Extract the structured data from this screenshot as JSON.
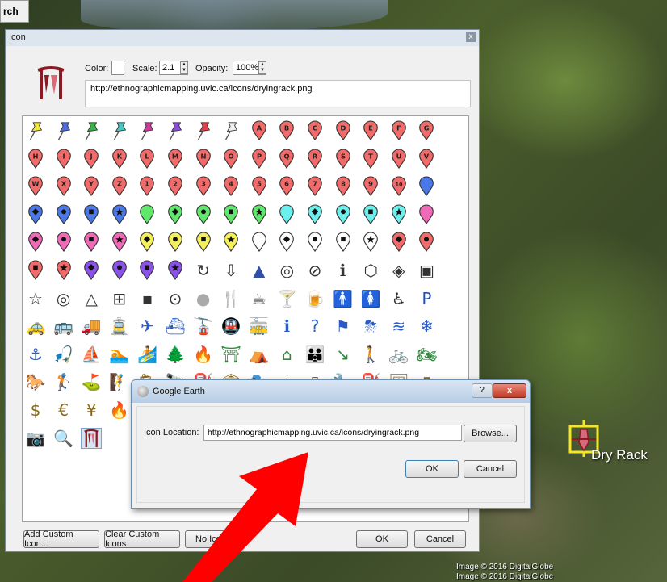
{
  "app": {
    "search_tab": "rch"
  },
  "icon_dialog": {
    "title": "Icon",
    "close_glyph": "x",
    "color_label": "Color:",
    "scale_label": "Scale:",
    "scale_value": "2.1",
    "opacity_label": "Opacity:",
    "opacity_value": "100%",
    "url": "http://ethnographicmapping.uvic.ca/icons/dryingrack.png",
    "buttons": {
      "add_custom": "Add Custom Icon...",
      "clear_custom": "Clear Custom Icons",
      "no_icon": "No Ico",
      "ok": "OK",
      "cancel": "Cancel"
    },
    "grid": {
      "rows": [
        [
          {
            "t": "pushpin",
            "c": "#f2e53c"
          },
          {
            "t": "pushpin",
            "c": "#4a6ee0"
          },
          {
            "t": "pushpin",
            "c": "#3bb34a"
          },
          {
            "t": "pushpin",
            "c": "#4bc6c0"
          },
          {
            "t": "pushpin",
            "c": "#d13a9d"
          },
          {
            "t": "pushpin",
            "c": "#8b4ed6"
          },
          {
            "t": "pushpin",
            "c": "#e0404a"
          },
          {
            "t": "pushpin",
            "c": "#eeeeee"
          },
          {
            "t": "pin",
            "c": "#f26b6b",
            "l": "A"
          },
          {
            "t": "pin",
            "c": "#f26b6b",
            "l": "B"
          },
          {
            "t": "pin",
            "c": "#f26b6b",
            "l": "C"
          },
          {
            "t": "pin",
            "c": "#f26b6b",
            "l": "D"
          },
          {
            "t": "pin",
            "c": "#f26b6b",
            "l": "E"
          },
          {
            "t": "pin",
            "c": "#f26b6b",
            "l": "F"
          },
          {
            "t": "pin",
            "c": "#f26b6b",
            "l": "G"
          }
        ],
        [
          {
            "t": "pin",
            "c": "#f26b6b",
            "l": "H"
          },
          {
            "t": "pin",
            "c": "#f26b6b",
            "l": "I"
          },
          {
            "t": "pin",
            "c": "#f26b6b",
            "l": "J"
          },
          {
            "t": "pin",
            "c": "#f26b6b",
            "l": "K"
          },
          {
            "t": "pin",
            "c": "#f26b6b",
            "l": "L"
          },
          {
            "t": "pin",
            "c": "#f26b6b",
            "l": "M"
          },
          {
            "t": "pin",
            "c": "#f26b6b",
            "l": "N"
          },
          {
            "t": "pin",
            "c": "#f26b6b",
            "l": "O"
          },
          {
            "t": "pin",
            "c": "#f26b6b",
            "l": "P"
          },
          {
            "t": "pin",
            "c": "#f26b6b",
            "l": "Q"
          },
          {
            "t": "pin",
            "c": "#f26b6b",
            "l": "R"
          },
          {
            "t": "pin",
            "c": "#f26b6b",
            "l": "S"
          },
          {
            "t": "pin",
            "c": "#f26b6b",
            "l": "T"
          },
          {
            "t": "pin",
            "c": "#f26b6b",
            "l": "U"
          },
          {
            "t": "pin",
            "c": "#f26b6b",
            "l": "V"
          }
        ],
        [
          {
            "t": "pin",
            "c": "#f26b6b",
            "l": "W"
          },
          {
            "t": "pin",
            "c": "#f26b6b",
            "l": "X"
          },
          {
            "t": "pin",
            "c": "#f26b6b",
            "l": "Y"
          },
          {
            "t": "pin",
            "c": "#f26b6b",
            "l": "Z"
          },
          {
            "t": "pin",
            "c": "#f26b6b",
            "l": "1"
          },
          {
            "t": "pin",
            "c": "#f26b6b",
            "l": "2"
          },
          {
            "t": "pin",
            "c": "#f26b6b",
            "l": "3"
          },
          {
            "t": "pin",
            "c": "#f26b6b",
            "l": "4"
          },
          {
            "t": "pin",
            "c": "#f26b6b",
            "l": "5"
          },
          {
            "t": "pin",
            "c": "#f26b6b",
            "l": "6"
          },
          {
            "t": "pin",
            "c": "#f26b6b",
            "l": "7"
          },
          {
            "t": "pin",
            "c": "#f26b6b",
            "l": "8"
          },
          {
            "t": "pin",
            "c": "#f26b6b",
            "l": "9"
          },
          {
            "t": "pin",
            "c": "#f26b6b",
            "l": "10"
          },
          {
            "t": "pin",
            "c": "#4a78e8"
          }
        ],
        [
          {
            "t": "pin",
            "c": "#4a78e8",
            "s": "diamond"
          },
          {
            "t": "pin",
            "c": "#4a78e8",
            "s": "circle"
          },
          {
            "t": "pin",
            "c": "#4a78e8",
            "s": "square"
          },
          {
            "t": "pin",
            "c": "#4a78e8",
            "s": "star"
          },
          {
            "t": "pin",
            "c": "#5fe86b"
          },
          {
            "t": "pin",
            "c": "#5fe86b",
            "s": "diamond"
          },
          {
            "t": "pin",
            "c": "#5fe86b",
            "s": "circle"
          },
          {
            "t": "pin",
            "c": "#5fe86b",
            "s": "square"
          },
          {
            "t": "pin",
            "c": "#5fe86b",
            "s": "star"
          },
          {
            "t": "pin",
            "c": "#6cf0ee"
          },
          {
            "t": "pin",
            "c": "#6cf0ee",
            "s": "diamond"
          },
          {
            "t": "pin",
            "c": "#6cf0ee",
            "s": "circle"
          },
          {
            "t": "pin",
            "c": "#6cf0ee",
            "s": "square"
          },
          {
            "t": "pin",
            "c": "#6cf0ee",
            "s": "star"
          },
          {
            "t": "pin",
            "c": "#f06ab8"
          }
        ],
        [
          {
            "t": "pin",
            "c": "#f06ab8",
            "s": "diamond"
          },
          {
            "t": "pin",
            "c": "#f06ab8",
            "s": "circle"
          },
          {
            "t": "pin",
            "c": "#f06ab8",
            "s": "square"
          },
          {
            "t": "pin",
            "c": "#f06ab8",
            "s": "star"
          },
          {
            "t": "pin",
            "c": "#f5ef5a",
            "s": "diamond"
          },
          {
            "t": "pin",
            "c": "#f5ef5a",
            "s": "circle"
          },
          {
            "t": "pin",
            "c": "#f5ef5a",
            "s": "square"
          },
          {
            "t": "pin",
            "c": "#f5ef5a",
            "s": "star"
          },
          {
            "t": "pin",
            "c": "#ffffff"
          },
          {
            "t": "pin",
            "c": "#ffffff",
            "s": "diamond"
          },
          {
            "t": "pin",
            "c": "#ffffff",
            "s": "circle"
          },
          {
            "t": "pin",
            "c": "#ffffff",
            "s": "square"
          },
          {
            "t": "pin",
            "c": "#ffffff",
            "s": "star"
          },
          {
            "t": "pin",
            "c": "#f26b6b",
            "s": "diamond"
          },
          {
            "t": "pin",
            "c": "#f26b6b",
            "s": "circle"
          }
        ],
        [
          {
            "t": "pin",
            "c": "#f26b6b",
            "s": "square"
          },
          {
            "t": "pin",
            "c": "#f26b6b",
            "s": "star"
          },
          {
            "t": "pin",
            "c": "#8a52e8",
            "s": "diamond"
          },
          {
            "t": "pin",
            "c": "#8a52e8",
            "s": "circle"
          },
          {
            "t": "pin",
            "c": "#8a52e8",
            "s": "square"
          },
          {
            "t": "pin",
            "c": "#8a52e8",
            "s": "star"
          },
          {
            "t": "g",
            "g": "↻"
          },
          {
            "t": "g",
            "g": "⇩"
          },
          {
            "t": "g",
            "g": "▲",
            "c": "#2f4fa8"
          },
          {
            "t": "g",
            "g": "◎"
          },
          {
            "t": "g",
            "g": "⊘"
          },
          {
            "t": "g",
            "g": "ℹ"
          },
          {
            "t": "g",
            "g": "⬡"
          },
          {
            "t": "g",
            "g": "◈"
          },
          {
            "t": "g",
            "g": "▣"
          }
        ],
        [
          {
            "t": "g",
            "g": "☆"
          },
          {
            "t": "g",
            "g": "◎"
          },
          {
            "t": "g",
            "g": "△"
          },
          {
            "t": "g",
            "g": "⊞"
          },
          {
            "t": "g",
            "g": "▪"
          },
          {
            "t": "g",
            "g": "⊙"
          },
          {
            "t": "g",
            "g": "●",
            "c": "#aaaaaa"
          },
          {
            "t": "g",
            "g": "🍴"
          },
          {
            "t": "g",
            "g": "☕"
          },
          {
            "t": "g",
            "g": "🍸"
          },
          {
            "t": "g",
            "g": "🍺"
          },
          {
            "t": "g",
            "g": "🚹"
          },
          {
            "t": "g",
            "g": "🚺"
          },
          {
            "t": "g",
            "g": "♿"
          },
          {
            "t": "g",
            "g": "P",
            "c": "#1c4fb8"
          }
        ],
        [
          {
            "t": "g",
            "g": "🚕",
            "c": "#2a5bc7"
          },
          {
            "t": "g",
            "g": "🚌",
            "c": "#2a5bc7"
          },
          {
            "t": "g",
            "g": "🚚",
            "c": "#2a5bc7"
          },
          {
            "t": "g",
            "g": "🚊",
            "c": "#2a5bc7"
          },
          {
            "t": "g",
            "g": "✈",
            "c": "#2a5bc7"
          },
          {
            "t": "g",
            "g": "⛴",
            "c": "#2a5bc7"
          },
          {
            "t": "g",
            "g": "🚡",
            "c": "#2a5bc7"
          },
          {
            "t": "g",
            "g": "🚇",
            "c": "#2a5bc7"
          },
          {
            "t": "g",
            "g": "🚋",
            "c": "#2a5bc7"
          },
          {
            "t": "g",
            "g": "ℹ",
            "c": "#2a5bc7"
          },
          {
            "t": "g",
            "g": "?",
            "c": "#2a5bc7"
          },
          {
            "t": "g",
            "g": "⚑",
            "c": "#2a5bc7"
          },
          {
            "t": "g",
            "g": "⛈",
            "c": "#2a5bc7"
          },
          {
            "t": "g",
            "g": "≋",
            "c": "#2a5bc7"
          },
          {
            "t": "g",
            "g": "❄",
            "c": "#2a5bc7"
          }
        ],
        [
          {
            "t": "g",
            "g": "⚓",
            "c": "#2a5bc7"
          },
          {
            "t": "g",
            "g": "🎣",
            "c": "#2a5bc7"
          },
          {
            "t": "g",
            "g": "⛵",
            "c": "#2a5bc7"
          },
          {
            "t": "g",
            "g": "🏊",
            "c": "#2a5bc7"
          },
          {
            "t": "g",
            "g": "🏄",
            "c": "#2a5bc7"
          },
          {
            "t": "g",
            "g": "🌲",
            "c": "#2f8a3a"
          },
          {
            "t": "g",
            "g": "🔥",
            "c": "#2f8a3a"
          },
          {
            "t": "g",
            "g": "⛩",
            "c": "#2f8a3a"
          },
          {
            "t": "g",
            "g": "⛺",
            "c": "#2f8a3a"
          },
          {
            "t": "g",
            "g": "⌂",
            "c": "#2f8a3a"
          },
          {
            "t": "g",
            "g": "👪",
            "c": "#2f8a3a"
          },
          {
            "t": "g",
            "g": "↘",
            "c": "#2f8a3a"
          },
          {
            "t": "g",
            "g": "🚶",
            "c": "#2f8a3a"
          },
          {
            "t": "g",
            "g": "🚲",
            "c": "#2f8a3a"
          },
          {
            "t": "g",
            "g": "🏍",
            "c": "#2f8a3a"
          }
        ],
        [
          {
            "t": "g",
            "g": "🐎",
            "c": "#2f8a3a"
          },
          {
            "t": "g",
            "g": "🏌",
            "c": "#2f8a3a"
          },
          {
            "t": "g",
            "g": "⛳",
            "c": "#2f8a3a"
          },
          {
            "t": "g",
            "g": "🧗",
            "c": "#2f8a3a"
          },
          {
            "t": "g",
            "g": "🛍",
            "c": "#8a6a1a"
          },
          {
            "t": "g",
            "g": "🔭",
            "c": "#8a6a1a"
          },
          {
            "t": "g",
            "g": "⛽",
            "c": "#8a6a1a"
          },
          {
            "t": "g",
            "g": "🏛",
            "c": "#8a6a1a"
          },
          {
            "t": "g",
            "g": "🎭",
            "c": "#8a6a1a"
          },
          {
            "t": "g",
            "g": "⌂",
            "c": "#8a6a1a"
          },
          {
            "t": "g",
            "g": "▯",
            "c": "#8a6a1a"
          },
          {
            "t": "g",
            "g": "🔧",
            "c": "#8a6a1a"
          },
          {
            "t": "g",
            "g": "⛽",
            "c": "#8a6a1a"
          },
          {
            "t": "g",
            "g": "🖼",
            "c": "#8a6a1a"
          },
          {
            "t": "g",
            "g": "▮",
            "c": "#8a6a1a"
          }
        ],
        [
          {
            "t": "g",
            "g": "$",
            "c": "#8a6a1a"
          },
          {
            "t": "g",
            "g": "€",
            "c": "#8a6a1a"
          },
          {
            "t": "g",
            "g": "¥",
            "c": "#8a6a1a"
          },
          {
            "t": "g",
            "g": "🔥",
            "c": "#c93a2a"
          }
        ],
        [
          {
            "t": "g",
            "g": "📷",
            "c": "#6a3ab8"
          },
          {
            "t": "g",
            "g": "🔍",
            "c": "#6a3ab8"
          },
          {
            "t": "rack"
          }
        ]
      ]
    }
  },
  "ge_dialog": {
    "title": "Google Earth",
    "help_glyph": "?",
    "close_glyph": "x",
    "icon_location_label": "Icon Location:",
    "icon_location_value": "http://ethnographicmapping.uvic.ca/icons/dryingrack.png",
    "browse": "Browse...",
    "ok": "OK",
    "cancel": "Cancel"
  },
  "map": {
    "placemark_label": "Dry Rack",
    "credits": [
      "Image © 2016 DigitalGlobe",
      "Image © 2016 DigitalGlobe"
    ]
  },
  "colors": {
    "arrow": "#ff0000",
    "pin_red": "#f26b6b",
    "rack": "#8a1a24"
  }
}
